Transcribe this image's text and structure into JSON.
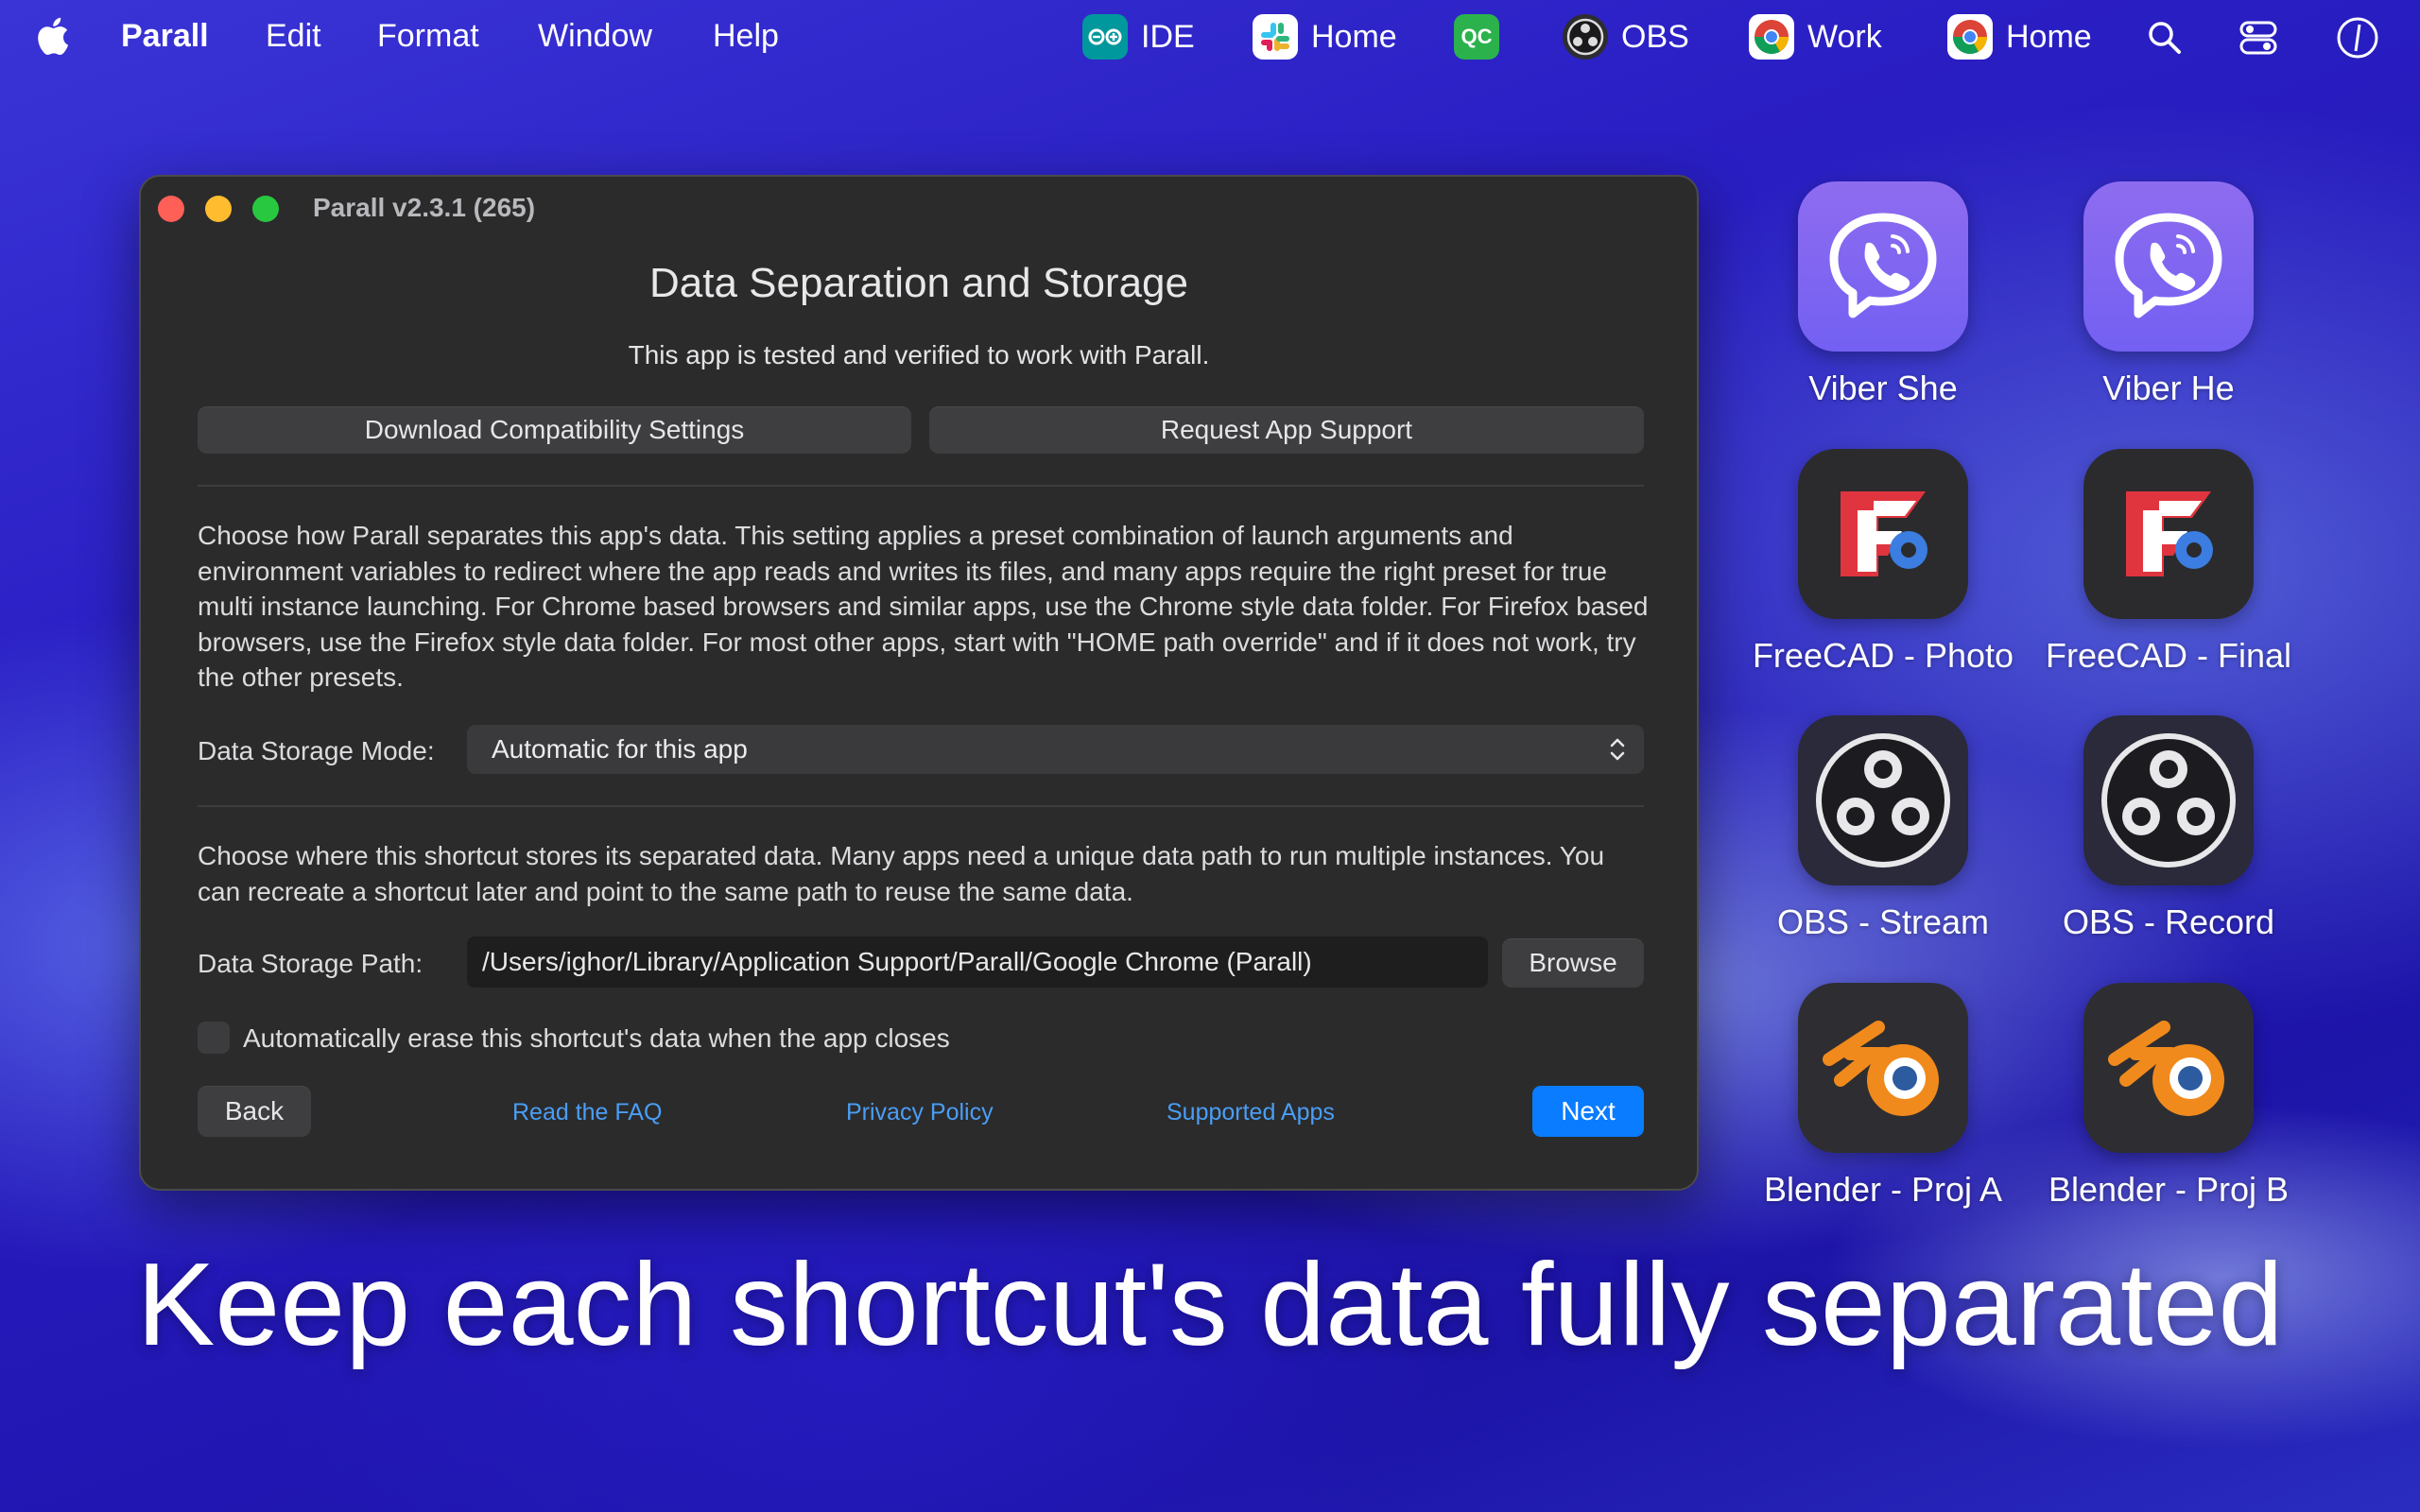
{
  "menubar": {
    "app_name": "Parall",
    "menus": [
      "Edit",
      "Format",
      "Window",
      "Help"
    ],
    "status_apps": [
      {
        "label": "IDE",
        "icon": "arduino-icon",
        "color": "#00979d"
      },
      {
        "label": "Home",
        "icon": "slack-icon",
        "color": "#ffffff"
      },
      {
        "label": "",
        "icon": "qc-icon",
        "color": "#2bb24c",
        "text": "QC"
      },
      {
        "label": "OBS",
        "icon": "obs-icon",
        "color": "#2d2d30"
      },
      {
        "label": "Work",
        "icon": "chrome-icon",
        "color": "#ffffff"
      },
      {
        "label": "Home",
        "icon": "chrome-icon",
        "color": "#ffffff"
      }
    ]
  },
  "window": {
    "title": "Parall v2.3.1 (265)",
    "heading": "Data Separation and Storage",
    "subheading": "This app is tested and verified to work with Parall.",
    "download_button": "Download Compatibility Settings",
    "request_button": "Request App Support",
    "mode_description": "Choose how Parall separates this app's data. This setting applies a preset combination of launch arguments and environment variables to redirect where the app reads and writes its files, and many apps require the right preset for true multi instance launching. For Chrome based browsers and similar apps, use the Chrome style data folder. For Firefox based browsers, use the Firefox style data folder. For most other apps, start with \"HOME path override\" and if it does not work, try the other presets.",
    "mode_label": "Data Storage Mode:",
    "mode_value": "Automatic for this app",
    "path_description": "Choose where this shortcut stores its separated data. Many apps need a unique data path to run multiple instances. You can recreate a shortcut later and point to the same path to reuse the same data.",
    "path_label": "Data Storage Path:",
    "path_value": "/Users/ighor/Library/Application Support/Parall/Google Chrome (Parall)",
    "browse_button": "Browse",
    "erase_checkbox_label": "Automatically erase this shortcut's data when the app closes",
    "erase_checked": false,
    "back_button": "Back",
    "faq_link": "Read the FAQ",
    "privacy_link": "Privacy Policy",
    "supported_link": "Supported Apps",
    "next_button": "Next",
    "accent_color": "#0a7cff"
  },
  "desktop_icons": [
    {
      "label": "Viber She",
      "icon": "viber-icon"
    },
    {
      "label": "Viber He",
      "icon": "viber-icon"
    },
    {
      "label": "FreeCAD - Photo",
      "icon": "freecad-icon"
    },
    {
      "label": "FreeCAD - Final",
      "icon": "freecad-icon"
    },
    {
      "label": "OBS - Stream",
      "icon": "obs-icon"
    },
    {
      "label": "OBS - Record",
      "icon": "obs-icon"
    },
    {
      "label": "Blender - Proj A",
      "icon": "blender-icon"
    },
    {
      "label": "Blender - Proj B",
      "icon": "blender-icon"
    }
  ],
  "tagline": "Keep each shortcut's data fully separated"
}
